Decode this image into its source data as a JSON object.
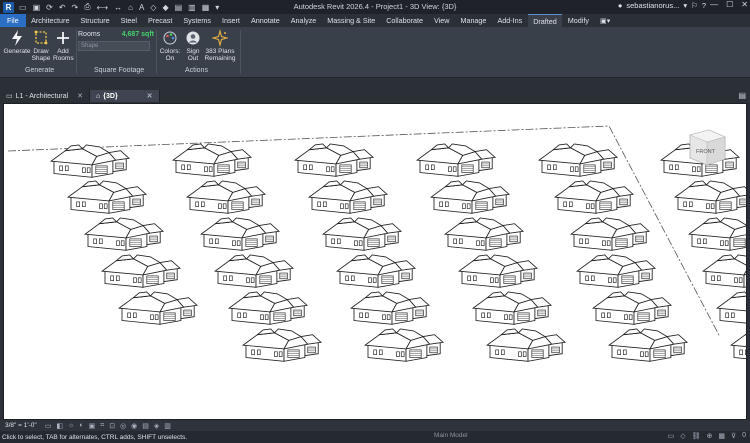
{
  "titlebar": {
    "app_title": "Autodesk Revit 2026.4 - Project1 - 3D View: {3D}",
    "user_name": "sebastianorus...",
    "logo_letter": "R"
  },
  "ribbon_tabs": [
    "File",
    "Architecture",
    "Structure",
    "Steel",
    "Precast",
    "Systems",
    "Insert",
    "Annotate",
    "Analyze",
    "Massing & Site",
    "Collaborate",
    "View",
    "Manage",
    "Add-Ins",
    "Drafted",
    "Modify"
  ],
  "ribbon": {
    "generate_label": "Generate",
    "draw_shape_label": "Draw Shape",
    "add_rooms_label": "Add Rooms",
    "rooms_label": "Rooms",
    "sqft_value": "4,687 sqft",
    "shape_placeholder": "Shape",
    "colors_label": "Colors: On",
    "sign_out_label": "Sign Out",
    "plans_label": "383 Plans Remaining",
    "group_generate": "Generate",
    "group_square_footage": "Square Footage",
    "group_actions": "Actions",
    "accent_color": "#44d06a"
  },
  "view_tabs": [
    {
      "label": "L1 - Architectural",
      "active": false
    },
    {
      "label": "{3D}",
      "active": true
    }
  ],
  "view": {
    "viewcube_label": "FRONT",
    "house_rows": [
      5,
      6,
      6,
      6,
      6,
      6
    ]
  },
  "view_control": {
    "scale": "3/8\" = 1'-0\""
  },
  "status": {
    "hint": "Click to select, TAB for alternates, CTRL adds, SHIFT unselects.",
    "model": "Main Model"
  }
}
